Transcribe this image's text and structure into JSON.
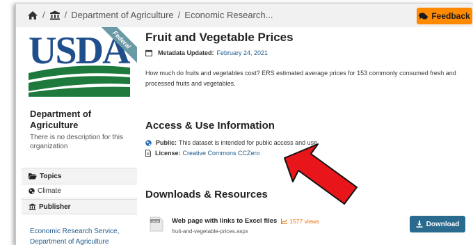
{
  "breadcrumb": {
    "items": [
      "Department of Agriculture",
      "Economic Research..."
    ],
    "separator": "/"
  },
  "feedback_label": "Feedback",
  "sidebar": {
    "logo_text": "USDA",
    "ribbon_text": "Federal",
    "org_name": "Department of Agriculture",
    "org_description": "There is no description for this organization",
    "topics_heading": "Topics",
    "topic_items": [
      "Climate"
    ],
    "publisher_heading": "Publisher",
    "publisher_name": "Economic Research Service, Department of Agriculture"
  },
  "dataset": {
    "title": "Fruit and Vegetable Prices",
    "metadata_label": "Metadata Updated:",
    "metadata_date": "February 24, 2021",
    "description": "How much do fruits and vegetables cost? ERS estimated average prices for 153 commonly consumed fresh and processed fruits and vegetables."
  },
  "access": {
    "heading": "Access & Use Information",
    "public_label": "Public:",
    "public_text": "This dataset is intended for public access and use.",
    "license_label": "License:",
    "license_link": "Creative Commons CCZero"
  },
  "downloads": {
    "heading": "Downloads & Resources",
    "resource_name": "Web page with links to Excel files",
    "views": "1577 views",
    "file_name": "fruit-and-vegetable-prices.aspx",
    "icon_text": "DATA",
    "download_label": "Download"
  },
  "colors": {
    "feedback": "#ff8a00",
    "usda_blue": "#1f4e8c",
    "usda_green": "#1e7a3c",
    "link": "#1f5a8b",
    "download": "#2a6a8e",
    "arrow": "#e8151b"
  }
}
